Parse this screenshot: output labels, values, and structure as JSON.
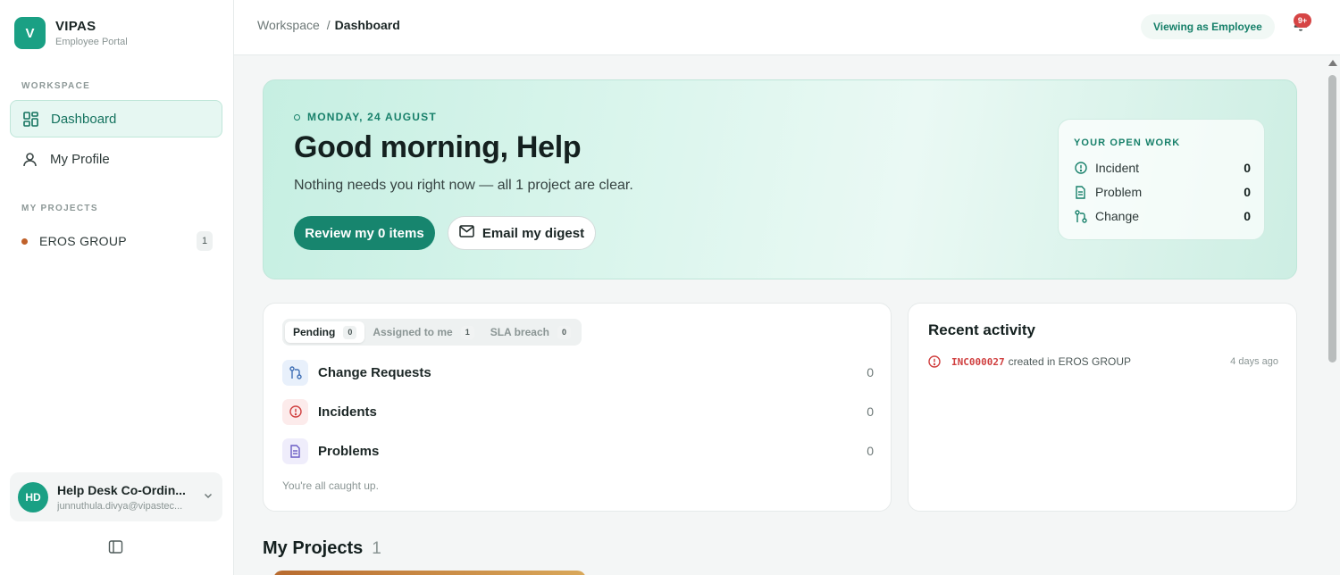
{
  "brand": {
    "logo_letter": "V",
    "name": "VIPAS",
    "subtitle": "Employee Portal",
    "color": "#1aa084"
  },
  "sidebar": {
    "workspace_label": "WORKSPACE",
    "nav": [
      {
        "label": "Dashboard",
        "icon": "dashboard-grid-icon",
        "active": true
      },
      {
        "label": "My Profile",
        "icon": "user-icon",
        "active": false
      }
    ],
    "projects_label": "MY PROJECTS",
    "projects": [
      {
        "name": "EROS GROUP",
        "count": "1",
        "dot_color": "#c0612a"
      }
    ]
  },
  "user": {
    "initials": "HD",
    "name": "Help Desk Co-Ordin...",
    "email": "junnuthula.divya@vipastec..."
  },
  "topbar": {
    "breadcrumb_root": "Workspace",
    "breadcrumb_sep": "/",
    "breadcrumb_current": "Dashboard",
    "viewing_as": "Viewing as Employee",
    "notification_badge": "9+"
  },
  "hero": {
    "date": "MONDAY, 24 AUGUST",
    "greeting": "Good morning, Help",
    "subtitle": "Nothing needs you right now — all 1 project are clear.",
    "primary_button": "Review my 0 items",
    "secondary_button": "Email my digest"
  },
  "open_work": {
    "title": "YOUR OPEN WORK",
    "items": [
      {
        "label": "Incident",
        "value": "0",
        "icon": "alert-circle-icon"
      },
      {
        "label": "Problem",
        "value": "0",
        "icon": "document-icon"
      },
      {
        "label": "Change",
        "value": "0",
        "icon": "git-pull-request-icon"
      }
    ]
  },
  "work": {
    "tabs": [
      {
        "label": "Pending",
        "count": "0",
        "active": true
      },
      {
        "label": "Assigned to me",
        "count": "1",
        "active": false
      },
      {
        "label": "SLA breach",
        "count": "0",
        "active": false
      }
    ],
    "rows": [
      {
        "label": "Change Requests",
        "count": "0",
        "icon": "git-pull-request-icon",
        "bg": "#e8f0fb"
      },
      {
        "label": "Incidents",
        "count": "0",
        "icon": "alert-circle-icon",
        "bg": "#fcebeb"
      },
      {
        "label": "Problems",
        "count": "0",
        "icon": "document-icon",
        "bg": "#efedfb"
      }
    ],
    "empty_text": "You're all caught up."
  },
  "activity": {
    "title": "Recent activity",
    "items": [
      {
        "id": "INC000027",
        "text": "created in EROS GROUP",
        "time": "4 days ago"
      }
    ]
  },
  "projects_section": {
    "title": "My Projects",
    "count": "1"
  }
}
